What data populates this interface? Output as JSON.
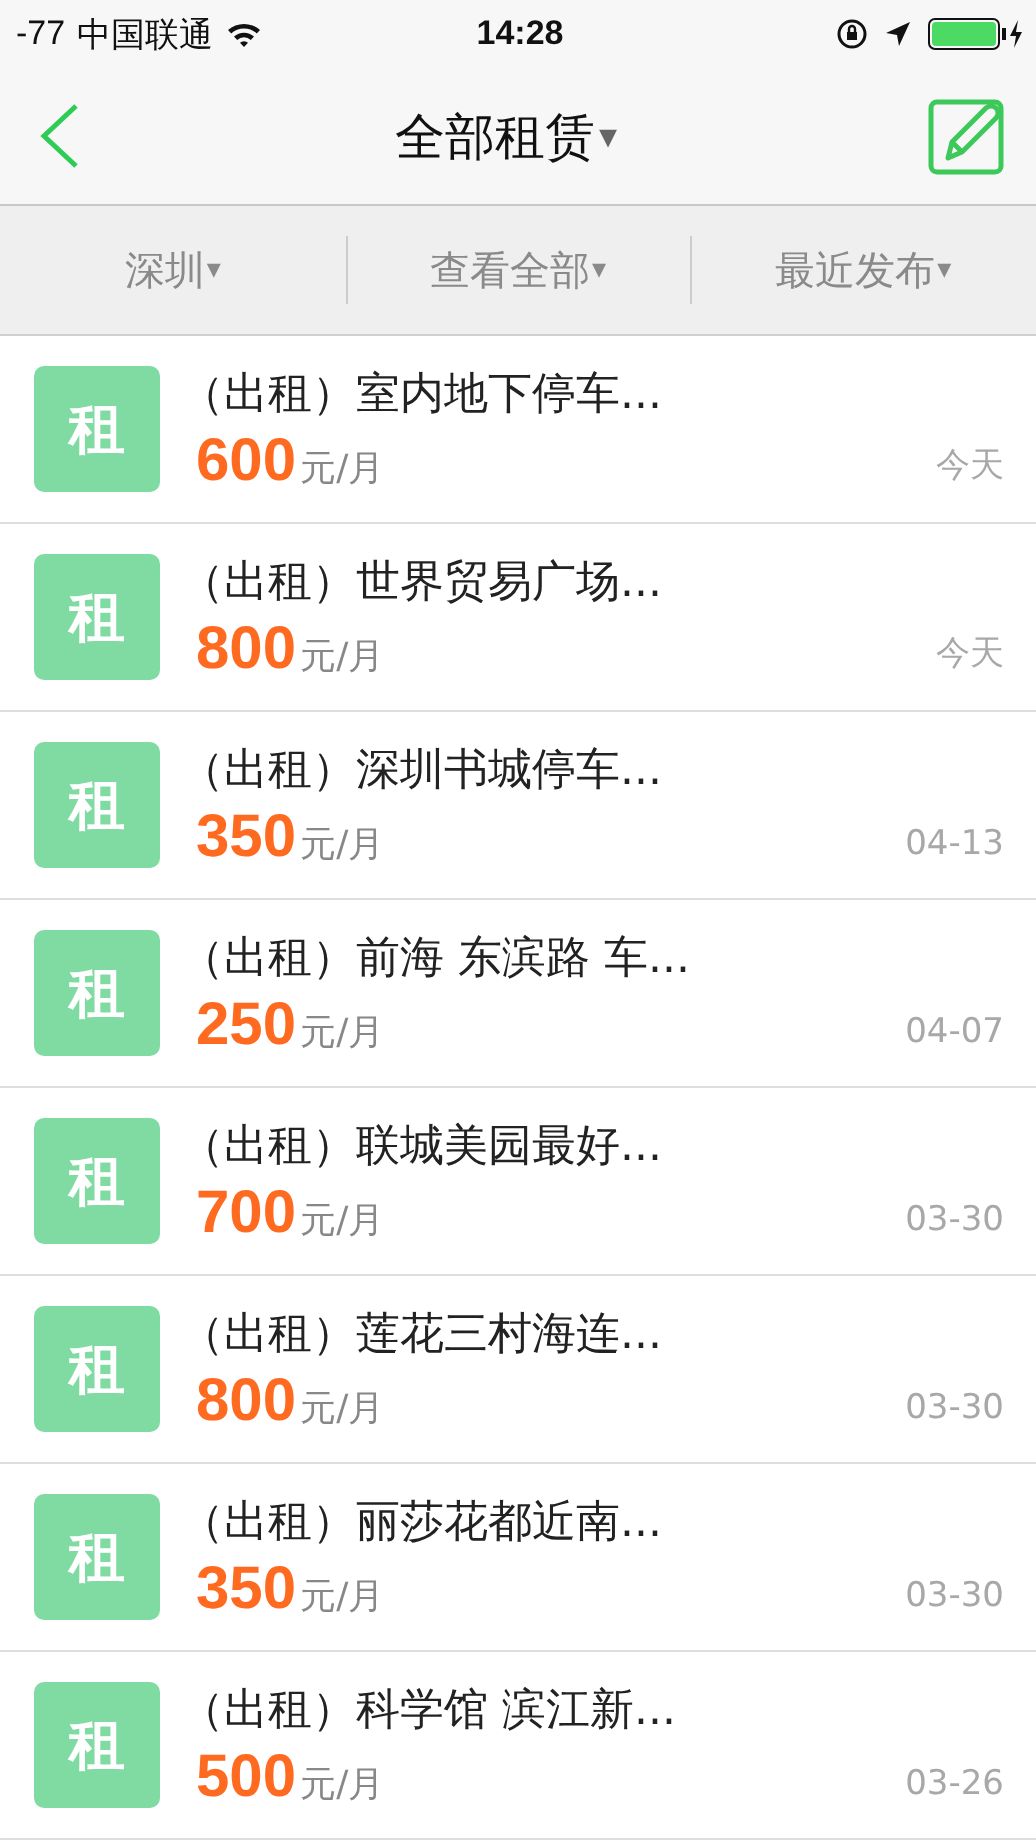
{
  "status_bar": {
    "signal": "-77",
    "carrier": "中国联通",
    "time": "14:28"
  },
  "nav": {
    "title": "全部租赁",
    "caret": "▾"
  },
  "filters": [
    {
      "label": "深圳",
      "caret": "▾"
    },
    {
      "label": "查看全部",
      "caret": "▾"
    },
    {
      "label": "最近发布",
      "caret": "▾"
    }
  ],
  "listings": [
    {
      "badge": "租",
      "title": "（出租）室内地下停车...",
      "price": "600",
      "unit": "元/月",
      "date": "今天"
    },
    {
      "badge": "租",
      "title": "（出租）世界贸易广场...",
      "price": "800",
      "unit": "元/月",
      "date": "今天"
    },
    {
      "badge": "租",
      "title": "（出租）深圳书城停车...",
      "price": "350",
      "unit": "元/月",
      "date": "04-13"
    },
    {
      "badge": "租",
      "title": "（出租）前海 东滨路 车...",
      "price": "250",
      "unit": "元/月",
      "date": "04-07"
    },
    {
      "badge": "租",
      "title": "（出租）联城美园最好...",
      "price": "700",
      "unit": "元/月",
      "date": "03-30"
    },
    {
      "badge": "租",
      "title": "（出租）莲花三村海连...",
      "price": "800",
      "unit": "元/月",
      "date": "03-30"
    },
    {
      "badge": "租",
      "title": "（出租）丽莎花都近南...",
      "price": "350",
      "unit": "元/月",
      "date": "03-30"
    },
    {
      "badge": "租",
      "title": "（出租）科学馆 滨江新...",
      "price": "500",
      "unit": "元/月",
      "date": "03-26"
    }
  ]
}
